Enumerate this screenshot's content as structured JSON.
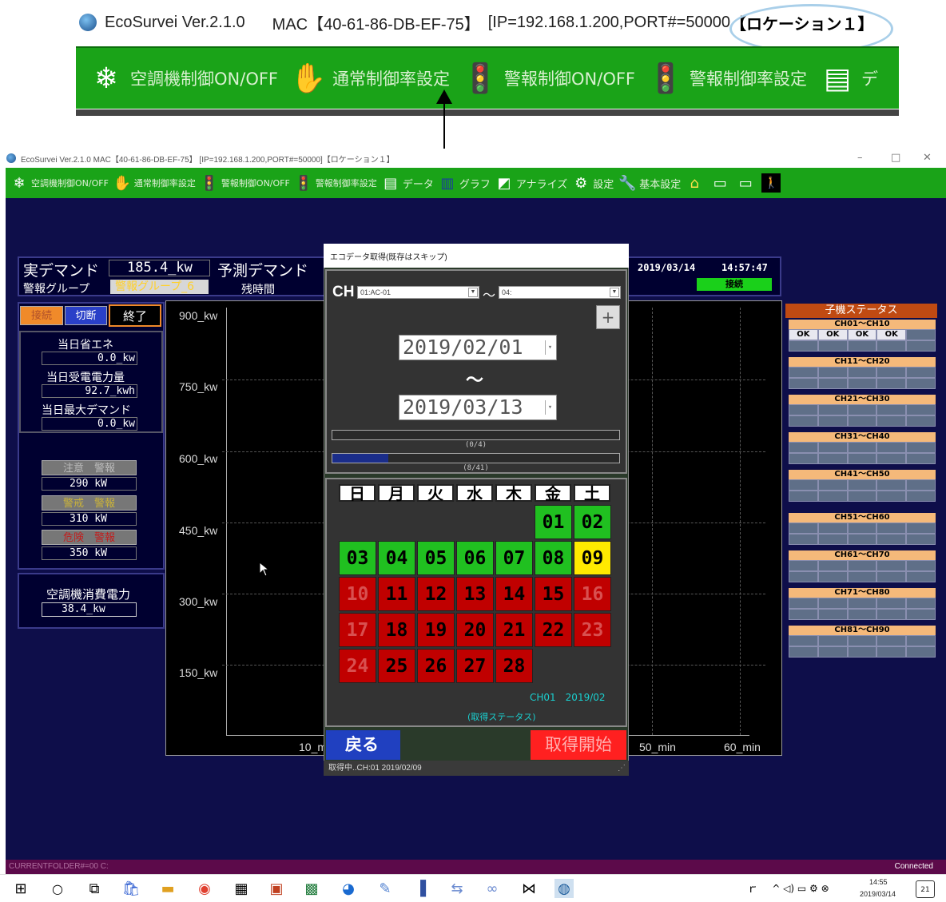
{
  "zoom": {
    "app_title": "EcoSurvei Ver.2.1.0",
    "mac": "MAC【40-61-86-DB-EF-75】",
    "ip": "[IP=192.168.1.200,PORT#=50000",
    "location": "【ロケーション１】",
    "menu": [
      {
        "label": "空調機制御ON/OFF",
        "icon": "snowflake-icon"
      },
      {
        "label": "通常制御率設定",
        "icon": "hand-icon"
      },
      {
        "label": "警報制御ON/OFF",
        "icon": "traffic-light-icon"
      },
      {
        "label": "警報制御率設定",
        "icon": "traffic-light-icon"
      },
      {
        "label": "デ",
        "icon": "data-icon"
      }
    ]
  },
  "window": {
    "title": "EcoSurvei Ver.2.1.0 MAC【40-61-86-DB-EF-75】 [IP=192.168.1.200,PORT#=50000]【ロケーション１】",
    "controls": [
      "–",
      "□",
      "✕"
    ]
  },
  "menubar": [
    {
      "label": "空調機制御ON/OFF",
      "icon": "snowflake-icon"
    },
    {
      "label": "通常制御率設定",
      "icon": "hand-icon"
    },
    {
      "label": "警報制御ON/OFF",
      "icon": "traffic-light-icon"
    },
    {
      "label": "警報制御率設定",
      "icon": "traffic-light-icon"
    },
    {
      "label": "データ",
      "icon": "data-icon"
    },
    {
      "label": "グラフ",
      "icon": "chart-icon"
    },
    {
      "label": "アナライズ",
      "icon": "analyze-icon"
    },
    {
      "label": "設定",
      "icon": "gear-icon"
    },
    {
      "label": "基本設定",
      "icon": "wrench-icon"
    }
  ],
  "header": {
    "actual_demand_label": "実デマンド",
    "actual_demand_value": "185.4_kw",
    "forecast_label": "予測デマンド",
    "alarm_group_label": "警報グループ",
    "alarm_group_value": "警報グループ_6",
    "remaining_label": "残時間",
    "date": "2019/03/14",
    "time": "14:57:47",
    "conn_status": "接続"
  },
  "left": {
    "connect": "接続",
    "disconnect": "切断",
    "exit": "終了",
    "daily_saving_label": "当日省エネ",
    "daily_saving_value": "0.0_kw",
    "daily_received_label": "当日受電電力量",
    "daily_received_value": "92.7_kwh",
    "daily_max_label": "当日最大デマンド",
    "daily_max_value": "0.0_kw",
    "caution_label": "注意　警報",
    "caution_value": "290 kW",
    "warning_label": "警戒　警報",
    "warning_value": "310 kW",
    "danger_label": "危険　警報",
    "danger_value": "350 kW",
    "ac_power_label": "空調機消費電力",
    "ac_power_value": "38.4_kw"
  },
  "chart": {
    "y_ticks": [
      "900_kw",
      "750_kw",
      "600_kw",
      "450_kw",
      "300_kw",
      "150_kw"
    ],
    "x_ticks": [
      "10_m",
      "50_min",
      "60_min"
    ]
  },
  "status": {
    "title": "子機ステータス",
    "groups": [
      {
        "label": "CH01～CH10",
        "cells": [
          "OK",
          "OK",
          "OK",
          "OK"
        ]
      },
      {
        "label": "CH11～CH20",
        "cells": []
      },
      {
        "label": "CH21～CH30",
        "cells": []
      },
      {
        "label": "CH31～CH40",
        "cells": []
      },
      {
        "label": "CH41～CH50",
        "cells": []
      },
      {
        "label": "CH51～CH60",
        "cells": []
      },
      {
        "label": "CH61～CH70",
        "cells": []
      },
      {
        "label": "CH71～CH80",
        "cells": []
      },
      {
        "label": "CH81～CH90",
        "cells": []
      }
    ]
  },
  "dialog": {
    "title": "エコデータ取得(既存はスキップ)",
    "ch_label": "CH",
    "ch_from": "01:AC-01",
    "ch_tilde": "～",
    "ch_to": "04:",
    "plus": "+",
    "date_from": "2019/02/01",
    "date_tilde": "～",
    "date_to": "2019/03/13",
    "progress1_label": "(0/4)",
    "progress1": 0.0,
    "progress2_label": "(8/41)",
    "progress2": 0.195,
    "weekdays": [
      "日",
      "月",
      "火",
      "水",
      "木",
      "金",
      "土"
    ],
    "days": [
      {
        "d": "01",
        "s": "g"
      },
      {
        "d": "02",
        "s": "g"
      },
      {
        "d": "03",
        "s": "g"
      },
      {
        "d": "04",
        "s": "g"
      },
      {
        "d": "05",
        "s": "g"
      },
      {
        "d": "06",
        "s": "g"
      },
      {
        "d": "07",
        "s": "g"
      },
      {
        "d": "08",
        "s": "g"
      },
      {
        "d": "09",
        "s": "y"
      },
      {
        "d": "10",
        "s": "rd"
      },
      {
        "d": "11",
        "s": "r"
      },
      {
        "d": "12",
        "s": "r"
      },
      {
        "d": "13",
        "s": "r"
      },
      {
        "d": "14",
        "s": "r"
      },
      {
        "d": "15",
        "s": "r"
      },
      {
        "d": "16",
        "s": "rd"
      },
      {
        "d": "17",
        "s": "rd"
      },
      {
        "d": "18",
        "s": "r"
      },
      {
        "d": "19",
        "s": "r"
      },
      {
        "d": "20",
        "s": "r"
      },
      {
        "d": "21",
        "s": "r"
      },
      {
        "d": "22",
        "s": "r"
      },
      {
        "d": "23",
        "s": "rd"
      },
      {
        "d": "24",
        "s": "rd"
      },
      {
        "d": "25",
        "s": "r"
      },
      {
        "d": "26",
        "s": "r"
      },
      {
        "d": "27",
        "s": "r"
      },
      {
        "d": "28",
        "s": "r"
      }
    ],
    "cal_info": "CH01　2019/02",
    "cal_status": "(取得ステータス)",
    "back": "戻る",
    "start": "取得開始",
    "footer": "取得中..CH:01 2019/02/09"
  },
  "statusbar": {
    "left": "CURRENTFOLDER#=00 C:",
    "right": "Connected"
  },
  "taskbar": {
    "time": "14:55",
    "date": "2019/03/14",
    "notif": "21"
  }
}
